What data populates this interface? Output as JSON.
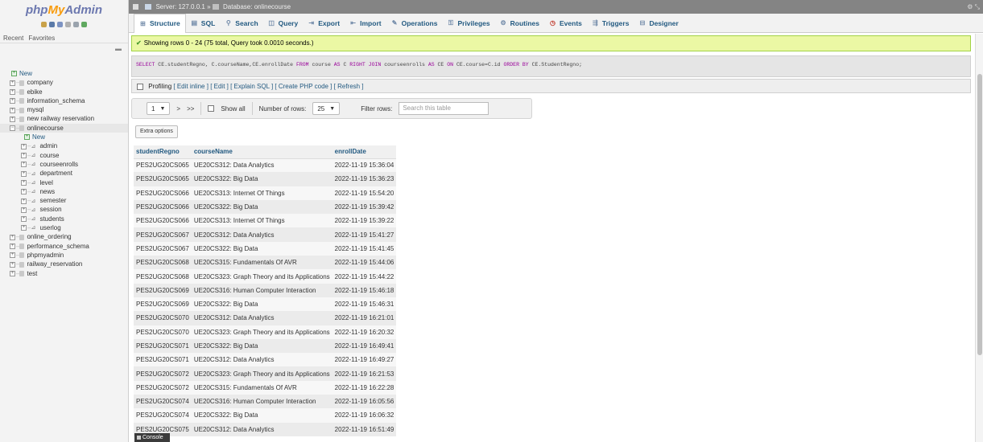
{
  "logo": {
    "part1": "php",
    "part2": "My",
    "part3": "Admin"
  },
  "nav_tabs": {
    "recent": "Recent",
    "favorites": "Favorites"
  },
  "tree": [
    {
      "label": "New",
      "kind": "new",
      "level": 0
    },
    {
      "label": "company",
      "kind": "db",
      "level": 0
    },
    {
      "label": "ebike",
      "kind": "db",
      "level": 0
    },
    {
      "label": "information_schema",
      "kind": "db",
      "level": 0
    },
    {
      "label": "mysql",
      "kind": "db",
      "level": 0
    },
    {
      "label": "new railway reservation",
      "kind": "db",
      "level": 0
    },
    {
      "label": "onlinecourse",
      "kind": "db-open",
      "level": 0
    },
    {
      "label": "New",
      "kind": "new",
      "level": 1
    },
    {
      "label": "admin",
      "kind": "table",
      "level": 1
    },
    {
      "label": "course",
      "kind": "table",
      "level": 1
    },
    {
      "label": "courseenrolls",
      "kind": "table",
      "level": 1
    },
    {
      "label": "department",
      "kind": "table",
      "level": 1
    },
    {
      "label": "level",
      "kind": "table",
      "level": 1
    },
    {
      "label": "news",
      "kind": "table",
      "level": 1
    },
    {
      "label": "semester",
      "kind": "table",
      "level": 1
    },
    {
      "label": "session",
      "kind": "table",
      "level": 1
    },
    {
      "label": "students",
      "kind": "table",
      "level": 1
    },
    {
      "label": "userlog",
      "kind": "table",
      "level": 1
    },
    {
      "label": "online_ordering",
      "kind": "db",
      "level": 0
    },
    {
      "label": "performance_schema",
      "kind": "db",
      "level": 0
    },
    {
      "label": "phpmyadmin",
      "kind": "db",
      "level": 0
    },
    {
      "label": "railway_reservation",
      "kind": "db",
      "level": 0
    },
    {
      "label": "test",
      "kind": "db",
      "level": 0
    }
  ],
  "breadcrumb": {
    "server": "Server: 127.0.0.1",
    "separator": "»",
    "database": "Database: onlinecourse"
  },
  "menu": [
    {
      "label": "Structure",
      "icon": "structure-icon",
      "glyph": "⊞",
      "active": true
    },
    {
      "label": "SQL",
      "icon": "sql-icon",
      "glyph": "▤"
    },
    {
      "label": "Search",
      "icon": "search-icon",
      "glyph": "⚲"
    },
    {
      "label": "Query",
      "icon": "query-icon",
      "glyph": "◫"
    },
    {
      "label": "Export",
      "icon": "export-icon",
      "glyph": "⇥"
    },
    {
      "label": "Import",
      "icon": "import-icon",
      "glyph": "⇤"
    },
    {
      "label": "Operations",
      "icon": "operations-icon",
      "glyph": "✎"
    },
    {
      "label": "Privileges",
      "icon": "privileges-icon",
      "glyph": "⚿"
    },
    {
      "label": "Routines",
      "icon": "routines-icon",
      "glyph": "⚙"
    },
    {
      "label": "Events",
      "icon": "events-icon",
      "glyph": "◷"
    },
    {
      "label": "Triggers",
      "icon": "triggers-icon",
      "glyph": "⇶"
    },
    {
      "label": "Designer",
      "icon": "designer-icon",
      "glyph": "⊟"
    }
  ],
  "status": {
    "message": "Showing rows 0 - 24 (75 total, Query took 0.0010 seconds.)",
    "color": "#ebf8a4"
  },
  "sql": {
    "tokens": [
      {
        "text": "SELECT",
        "kw": true
      },
      {
        "text": " CE.studentRegno, C.courseName,CE.enrollDate ",
        "kw": false
      },
      {
        "text": "FROM",
        "kw": true
      },
      {
        "text": " course ",
        "kw": false
      },
      {
        "text": "AS",
        "kw": true
      },
      {
        "text": " C ",
        "kw": false
      },
      {
        "text": "RIGHT JOIN",
        "kw": true
      },
      {
        "text": " courseenrolls ",
        "kw": false
      },
      {
        "text": "AS",
        "kw": true
      },
      {
        "text": " CE ",
        "kw": false
      },
      {
        "text": "ON",
        "kw": true
      },
      {
        "text": " CE.course=C.id ",
        "kw": false
      },
      {
        "text": "ORDER BY",
        "kw": true
      },
      {
        "text": " CE.StudentRegno;",
        "kw": false
      }
    ]
  },
  "profiling": {
    "label": "Profiling",
    "links": [
      "[ Edit inline ]",
      "[ Edit ]",
      "[ Explain SQL ]",
      "[ Create PHP code ]",
      "[ Refresh ]"
    ]
  },
  "pager": {
    "page": "1",
    "next": ">",
    "last": ">>",
    "show_all": "Show all",
    "rows_label": "Number of rows:",
    "rows_value": "25",
    "filter_label": "Filter rows:",
    "filter_placeholder": "Search this table"
  },
  "extra_options": "Extra options",
  "table": {
    "columns": [
      "studentRegno",
      "courseName",
      "enrollDate"
    ],
    "rows": [
      [
        "PES2UG20CS065",
        "UE20CS312: Data Analytics",
        "2022-11-19 15:36:04"
      ],
      [
        "PES2UG20CS065",
        "UE20CS322: Big Data",
        "2022-11-19 15:36:23"
      ],
      [
        "PES2UG20CS066",
        "UE20CS313: Internet Of Things",
        "2022-11-19 15:54:20"
      ],
      [
        "PES2UG20CS066",
        "UE20CS322: Big Data",
        "2022-11-19 15:39:42"
      ],
      [
        "PES2UG20CS066",
        "UE20CS313: Internet Of Things",
        "2022-11-19 15:39:22"
      ],
      [
        "PES2UG20CS067",
        "UE20CS312: Data Analytics",
        "2022-11-19 15:41:27"
      ],
      [
        "PES2UG20CS067",
        "UE20CS322: Big Data",
        "2022-11-19 15:41:45"
      ],
      [
        "PES2UG20CS068",
        "UE20CS315: Fundamentals Of AVR",
        "2022-11-19 15:44:06"
      ],
      [
        "PES2UG20CS068",
        "UE20CS323: Graph Theory and its Applications",
        "2022-11-19 15:44:22"
      ],
      [
        "PES2UG20CS069",
        "UE20CS316: Human Computer Interaction",
        "2022-11-19 15:46:18"
      ],
      [
        "PES2UG20CS069",
        "UE20CS322: Big Data",
        "2022-11-19 15:46:31"
      ],
      [
        "PES2UG20CS070",
        "UE20CS312: Data Analytics",
        "2022-11-19 16:21:01"
      ],
      [
        "PES2UG20CS070",
        "UE20CS323: Graph Theory and its Applications",
        "2022-11-19 16:20:32"
      ],
      [
        "PES2UG20CS071",
        "UE20CS322: Big Data",
        "2022-11-19 16:49:41"
      ],
      [
        "PES2UG20CS071",
        "UE20CS312: Data Analytics",
        "2022-11-19 16:49:27"
      ],
      [
        "PES2UG20CS072",
        "UE20CS323: Graph Theory and its Applications",
        "2022-11-19 16:21:53"
      ],
      [
        "PES2UG20CS072",
        "UE20CS315: Fundamentals Of AVR",
        "2022-11-19 16:22:28"
      ],
      [
        "PES2UG20CS074",
        "UE20CS316: Human Computer Interaction",
        "2022-11-19 16:05:56"
      ],
      [
        "PES2UG20CS074",
        "UE20CS322: Big Data",
        "2022-11-19 16:06:32"
      ],
      [
        "PES2UG20CS075",
        "UE20CS312: Data Analytics",
        "2022-11-19 16:51:49"
      ]
    ]
  },
  "console": {
    "label": "Console"
  },
  "colors": {
    "brand": "#6c78af",
    "accent": "#f89c0e",
    "link": "#235a81",
    "success_border": "#a2d246",
    "sql_keyword": "#990099"
  }
}
